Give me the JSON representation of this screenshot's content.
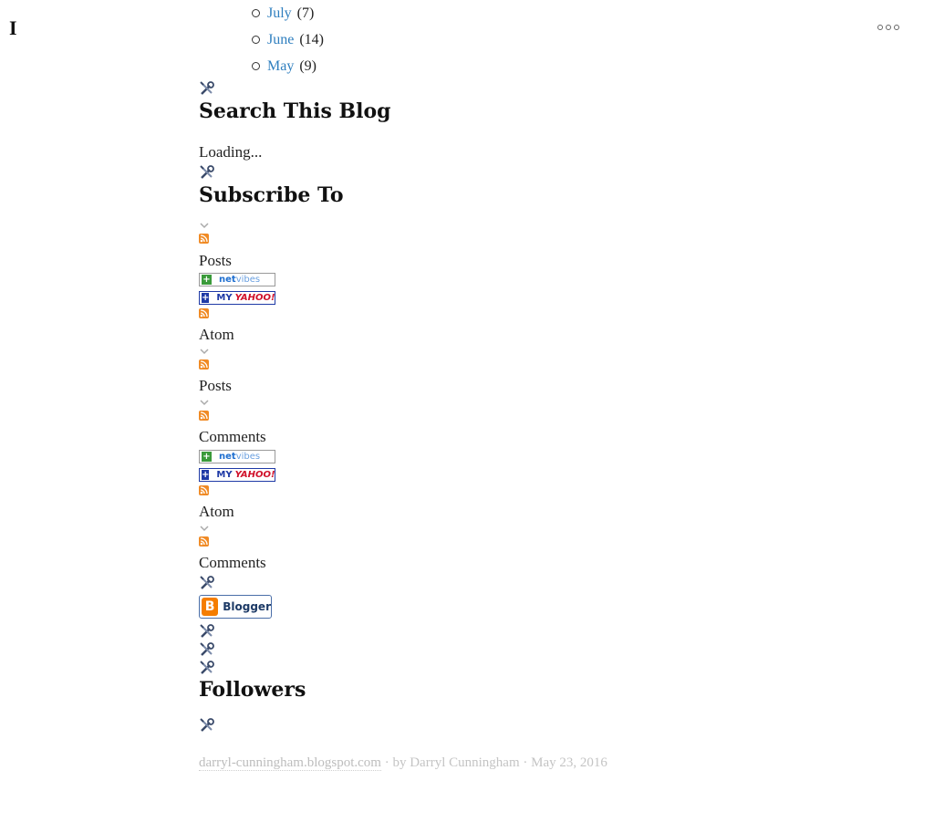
{
  "page": {
    "corner_letter": "I"
  },
  "archive": {
    "items": [
      {
        "month": "July",
        "count": "(7)"
      },
      {
        "month": "June",
        "count": "(14)"
      },
      {
        "month": "May",
        "count": "(9)"
      }
    ]
  },
  "search": {
    "title": "Search This Blog",
    "status": "Loading..."
  },
  "subscribe": {
    "title": "Subscribe To",
    "posts_label": "Posts",
    "atom_label": "Atom",
    "comments_label": "Comments",
    "netvibes": {
      "part1": "net",
      "part2": "vibes"
    },
    "yahoo": {
      "part1": "MY",
      "part2": "YAHOO!"
    }
  },
  "blogger_button": {
    "label": "Blogger"
  },
  "followers": {
    "title": "Followers"
  },
  "footer": {
    "site": "darryl-cunningham.blogspot.com",
    "byline": " · by Darryl Cunningham · May 23, 2016"
  },
  "colors": {
    "link": "#2f7fbf",
    "rss": "#f08a24",
    "blogger": "#f57d00"
  }
}
